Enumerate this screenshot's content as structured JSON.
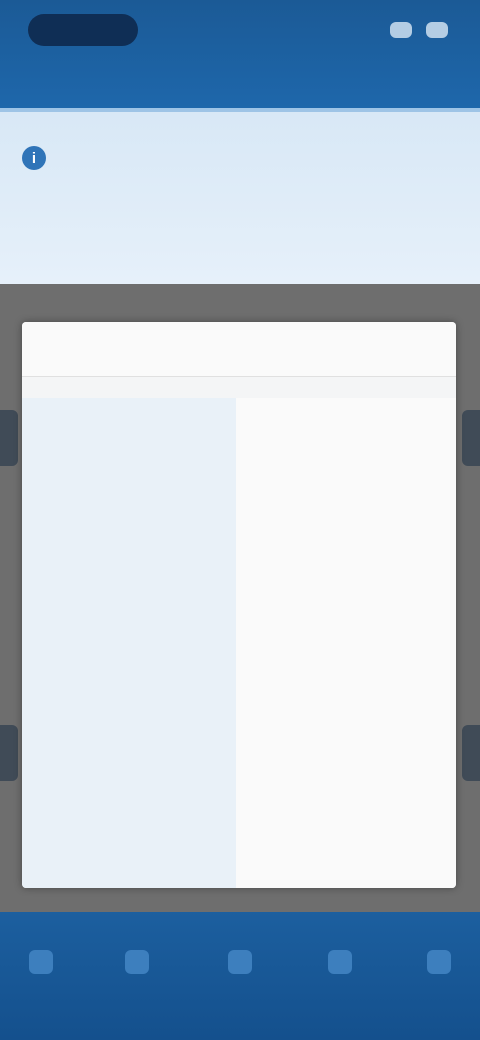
{
  "topbar": {
    "app_name": "",
    "subtitle": ""
  },
  "banner": {
    "icon": "info-icon",
    "title": "",
    "body": "",
    "link": ""
  },
  "card": {
    "title": "",
    "rows": [
      {
        "label": "",
        "value": "",
        "value_color": "#b6414a"
      },
      {
        "label": "",
        "value": ""
      },
      {
        "label": "",
        "value": ""
      },
      {
        "label": "",
        "value": ""
      },
      {
        "label": "",
        "value": ""
      },
      {
        "label": "",
        "value": ""
      },
      {
        "label": "",
        "value": ""
      }
    ]
  },
  "bottom_nav": {
    "items": [
      {
        "icon": "home-icon",
        "label": ""
      },
      {
        "icon": "list-icon",
        "label": ""
      },
      {
        "icon": "grid-icon",
        "label": ""
      },
      {
        "icon": "chat-icon",
        "label": ""
      },
      {
        "icon": "menu-icon",
        "label": ""
      }
    ]
  },
  "colors": {
    "primary": "#1e67ab",
    "banner_bg": "#e0edf8",
    "accent_red": "#b6414a"
  }
}
